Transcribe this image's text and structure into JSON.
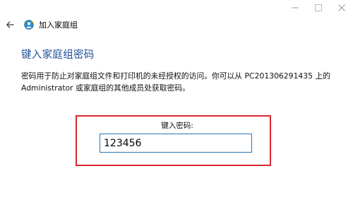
{
  "window_controls": {
    "minimize_icon": "minimize-icon",
    "maximize_icon": "maximize-icon",
    "close_icon": "close-icon"
  },
  "titlebar": {
    "back_icon": "back-arrow-icon",
    "app_icon": "homegroup-icon",
    "title": "加入家庭组"
  },
  "page": {
    "heading": "键入家庭组密码",
    "description": "密码用于防止对家庭组文件和打印机的未经授权的访问。你可以从 PC201306291435 上的 Administrator 或家庭组的其他成员处获取密码。"
  },
  "password": {
    "label": "键入密码:",
    "value": "123456"
  },
  "colors": {
    "heading": "#1f4e9c",
    "highlight_border": "#d9282e",
    "input_border": "#2a74b6"
  }
}
